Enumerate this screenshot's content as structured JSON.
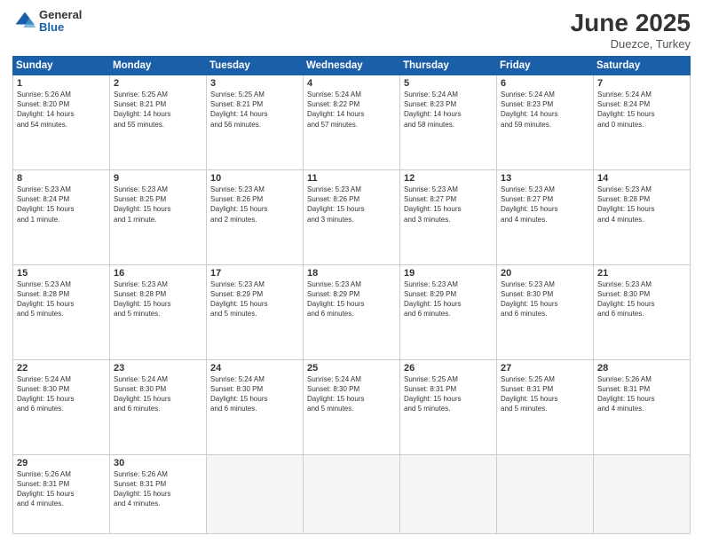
{
  "logo": {
    "general": "General",
    "blue": "Blue"
  },
  "header": {
    "month": "June 2025",
    "location": "Duezce, Turkey"
  },
  "weekdays": [
    "Sunday",
    "Monday",
    "Tuesday",
    "Wednesday",
    "Thursday",
    "Friday",
    "Saturday"
  ],
  "weeks": [
    [
      {
        "day": "1",
        "info": "Sunrise: 5:26 AM\nSunset: 8:20 PM\nDaylight: 14 hours\nand 54 minutes."
      },
      {
        "day": "2",
        "info": "Sunrise: 5:25 AM\nSunset: 8:21 PM\nDaylight: 14 hours\nand 55 minutes."
      },
      {
        "day": "3",
        "info": "Sunrise: 5:25 AM\nSunset: 8:21 PM\nDaylight: 14 hours\nand 56 minutes."
      },
      {
        "day": "4",
        "info": "Sunrise: 5:24 AM\nSunset: 8:22 PM\nDaylight: 14 hours\nand 57 minutes."
      },
      {
        "day": "5",
        "info": "Sunrise: 5:24 AM\nSunset: 8:23 PM\nDaylight: 14 hours\nand 58 minutes."
      },
      {
        "day": "6",
        "info": "Sunrise: 5:24 AM\nSunset: 8:23 PM\nDaylight: 14 hours\nand 59 minutes."
      },
      {
        "day": "7",
        "info": "Sunrise: 5:24 AM\nSunset: 8:24 PM\nDaylight: 15 hours\nand 0 minutes."
      }
    ],
    [
      {
        "day": "8",
        "info": "Sunrise: 5:23 AM\nSunset: 8:24 PM\nDaylight: 15 hours\nand 1 minute."
      },
      {
        "day": "9",
        "info": "Sunrise: 5:23 AM\nSunset: 8:25 PM\nDaylight: 15 hours\nand 1 minute."
      },
      {
        "day": "10",
        "info": "Sunrise: 5:23 AM\nSunset: 8:26 PM\nDaylight: 15 hours\nand 2 minutes."
      },
      {
        "day": "11",
        "info": "Sunrise: 5:23 AM\nSunset: 8:26 PM\nDaylight: 15 hours\nand 3 minutes."
      },
      {
        "day": "12",
        "info": "Sunrise: 5:23 AM\nSunset: 8:27 PM\nDaylight: 15 hours\nand 3 minutes."
      },
      {
        "day": "13",
        "info": "Sunrise: 5:23 AM\nSunset: 8:27 PM\nDaylight: 15 hours\nand 4 minutes."
      },
      {
        "day": "14",
        "info": "Sunrise: 5:23 AM\nSunset: 8:28 PM\nDaylight: 15 hours\nand 4 minutes."
      }
    ],
    [
      {
        "day": "15",
        "info": "Sunrise: 5:23 AM\nSunset: 8:28 PM\nDaylight: 15 hours\nand 5 minutes."
      },
      {
        "day": "16",
        "info": "Sunrise: 5:23 AM\nSunset: 8:28 PM\nDaylight: 15 hours\nand 5 minutes."
      },
      {
        "day": "17",
        "info": "Sunrise: 5:23 AM\nSunset: 8:29 PM\nDaylight: 15 hours\nand 5 minutes."
      },
      {
        "day": "18",
        "info": "Sunrise: 5:23 AM\nSunset: 8:29 PM\nDaylight: 15 hours\nand 6 minutes."
      },
      {
        "day": "19",
        "info": "Sunrise: 5:23 AM\nSunset: 8:29 PM\nDaylight: 15 hours\nand 6 minutes."
      },
      {
        "day": "20",
        "info": "Sunrise: 5:23 AM\nSunset: 8:30 PM\nDaylight: 15 hours\nand 6 minutes."
      },
      {
        "day": "21",
        "info": "Sunrise: 5:23 AM\nSunset: 8:30 PM\nDaylight: 15 hours\nand 6 minutes."
      }
    ],
    [
      {
        "day": "22",
        "info": "Sunrise: 5:24 AM\nSunset: 8:30 PM\nDaylight: 15 hours\nand 6 minutes."
      },
      {
        "day": "23",
        "info": "Sunrise: 5:24 AM\nSunset: 8:30 PM\nDaylight: 15 hours\nand 6 minutes."
      },
      {
        "day": "24",
        "info": "Sunrise: 5:24 AM\nSunset: 8:30 PM\nDaylight: 15 hours\nand 6 minutes."
      },
      {
        "day": "25",
        "info": "Sunrise: 5:24 AM\nSunset: 8:30 PM\nDaylight: 15 hours\nand 5 minutes."
      },
      {
        "day": "26",
        "info": "Sunrise: 5:25 AM\nSunset: 8:31 PM\nDaylight: 15 hours\nand 5 minutes."
      },
      {
        "day": "27",
        "info": "Sunrise: 5:25 AM\nSunset: 8:31 PM\nDaylight: 15 hours\nand 5 minutes."
      },
      {
        "day": "28",
        "info": "Sunrise: 5:26 AM\nSunset: 8:31 PM\nDaylight: 15 hours\nand 4 minutes."
      }
    ],
    [
      {
        "day": "29",
        "info": "Sunrise: 5:26 AM\nSunset: 8:31 PM\nDaylight: 15 hours\nand 4 minutes."
      },
      {
        "day": "30",
        "info": "Sunrise: 5:26 AM\nSunset: 8:31 PM\nDaylight: 15 hours\nand 4 minutes."
      },
      {
        "day": "",
        "info": ""
      },
      {
        "day": "",
        "info": ""
      },
      {
        "day": "",
        "info": ""
      },
      {
        "day": "",
        "info": ""
      },
      {
        "day": "",
        "info": ""
      }
    ]
  ]
}
